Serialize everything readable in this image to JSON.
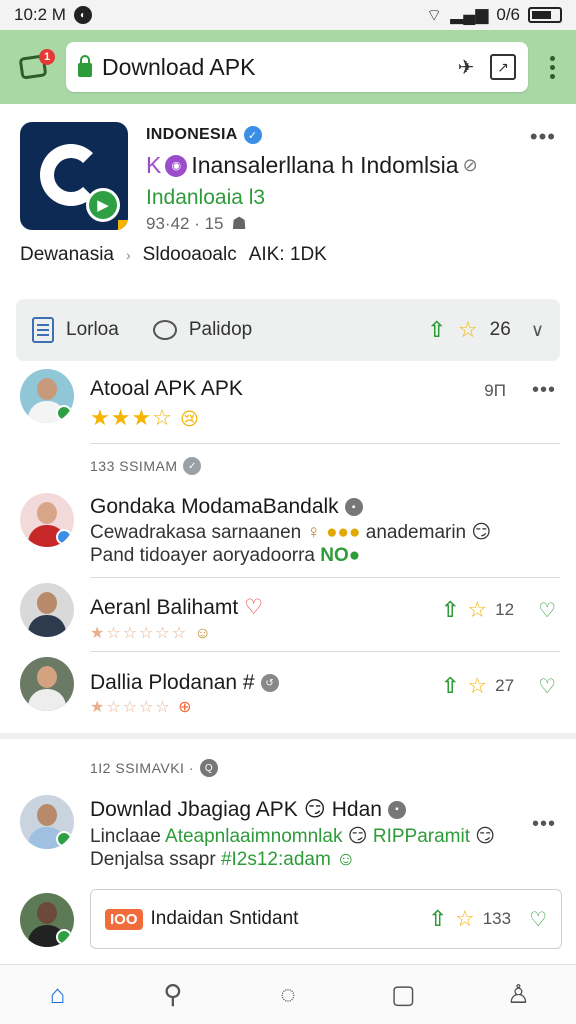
{
  "status_bar": {
    "time": "10:2 M",
    "battery_label": "0/6"
  },
  "toolbar": {
    "tabs_count": "1",
    "url": "Download APK"
  },
  "header": {
    "publisher": "INDONESIA",
    "app_name": "Inansalerllana h Indomlsia",
    "app_subtitle": "Indanloaia l3",
    "app_meta": "93·42 · 15",
    "crumb_1": "Dewanasia",
    "crumb_2": "Sldooaoalc",
    "crumb_3": "AIK: 1DK"
  },
  "action_bar": {
    "item_1": "Lorloa",
    "item_2": "Palidop",
    "count": "26"
  },
  "posts": [
    {
      "name": "Atooal APK APK",
      "stars": "★★★☆",
      "right_value": "9П"
    },
    {
      "section_label": "133 SSIMAM",
      "name": "Gondaka ModamaBandalk",
      "line_1": "Cewadrakasa sarnaanen",
      "line_1b": "anademarin",
      "line_2": "Pand tidoayer aoryadoorra",
      "line_2_tag": "NO"
    },
    {
      "name": "Aeranl Balihamt",
      "stars": "★☆☆☆☆☆",
      "count": "12"
    },
    {
      "name": "Dallia Plodanan #",
      "stars": "★☆☆☆☆",
      "count": "27"
    },
    {
      "section_label": "1I2 SSIMAVKI ·",
      "name": "Downlad Jbagiag APK",
      "name_suffix": "Hdan",
      "line_1a": "Linclaae",
      "line_1b": "Ateapnlaaimnomnlak",
      "line_1c": "RIPParamit",
      "line_2a": "Denjalsa ssapr",
      "line_2b": "#I2s12:adam"
    }
  ],
  "comment_box": {
    "tag": "IOO",
    "text": "Indaidan Sntidant",
    "count": "133"
  },
  "icons": {
    "accent_green": "#2e9b39",
    "toolbar_green": "#a9d8a5",
    "star_gold": "#f4b400",
    "nav_active_blue": "#1e6fd9"
  }
}
